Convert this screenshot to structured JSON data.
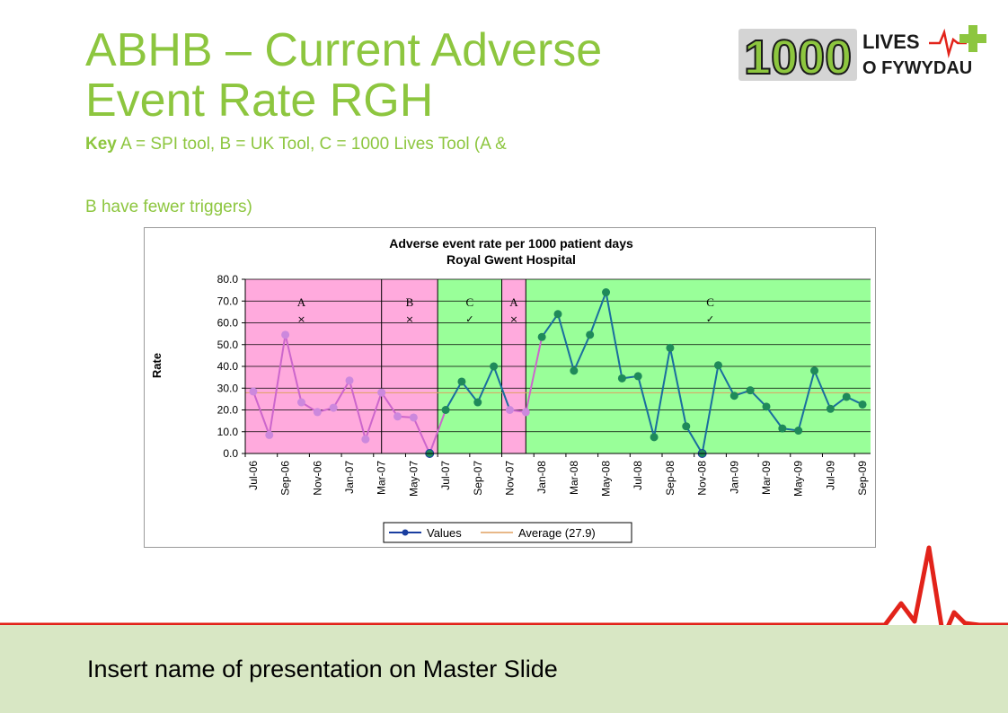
{
  "slide": {
    "title": "ABHB – Current Adverse Event Rate RGH",
    "key_label": "Key",
    "key_text": "A = SPI tool,   B = UK Tool,    C = 1000 Lives Tool      (A &",
    "key_text_2": "B have fewer triggers)",
    "footer": "Insert name of presentation on Master Slide"
  },
  "logo": {
    "number": "1000",
    "line1": "LIVES",
    "line2": "O FYWYDAU",
    "colors": {
      "green": "#8dc63f",
      "red": "#e2231a",
      "dark": "#1a1a1a"
    }
  },
  "chart_data": {
    "type": "line",
    "title": "Adverse event rate per 1000 patient days",
    "subtitle": "Royal Gwent Hospital",
    "ylabel": "Rate",
    "ylim": [
      0,
      80
    ],
    "yticks": [
      "0.0",
      "10.0",
      "20.0",
      "30.0",
      "40.0",
      "50.0",
      "60.0",
      "70.0",
      "80.0"
    ],
    "x_tick_labels": [
      "Jul-06",
      "Sep-06",
      "Nov-06",
      "Jan-07",
      "Mar-07",
      "May-07",
      "Jul-07",
      "Sep-07",
      "Nov-07",
      "Jan-08",
      "Mar-08",
      "May-08",
      "Jul-08",
      "Sep-08",
      "Nov-08",
      "Jan-09",
      "Mar-09",
      "May-09",
      "Jul-09",
      "Sep-09"
    ],
    "n_points": 39,
    "series": [
      {
        "name": "Values",
        "values": [
          28.5,
          8.5,
          54.5,
          23.5,
          19,
          21,
          33.5,
          6.5,
          28,
          17,
          16.5,
          0,
          20,
          33,
          23.5,
          40,
          20,
          19,
          53.5,
          64,
          38,
          54.5,
          74,
          34.5,
          35.5,
          7.5,
          48.5,
          12.5,
          0,
          40.5,
          26.5,
          29,
          21.5,
          11.5,
          10.5,
          38,
          20.5,
          26,
          22.5
        ]
      }
    ],
    "average": {
      "name": "Average (27.9)",
      "value": 27.9
    },
    "legend": [
      "Values",
      "Average (27.9)"
    ],
    "legend_position": "bottom",
    "regions": [
      {
        "label": "A",
        "mark": "×",
        "color": "#ffaadd",
        "from": 0,
        "to": 8.5
      },
      {
        "label": "B",
        "mark": "×",
        "color": "#ffaadd",
        "from": 8.5,
        "to": 12
      },
      {
        "label": "C",
        "mark": "✓",
        "color": "#99ff99",
        "from": 12,
        "to": 16
      },
      {
        "label": "A",
        "mark": "×",
        "color": "#ffaadd",
        "from": 16,
        "to": 17.5
      },
      {
        "label": "C",
        "mark": "✓",
        "color": "#99ff99",
        "from": 17.5,
        "to": 39
      }
    ],
    "colors": {
      "pink_line": "#cc66cc",
      "pink_marker": "#cc88dd",
      "green_line": "#1a6e9e",
      "green_marker": "#1f8a5a",
      "average": "#e0a060"
    }
  }
}
